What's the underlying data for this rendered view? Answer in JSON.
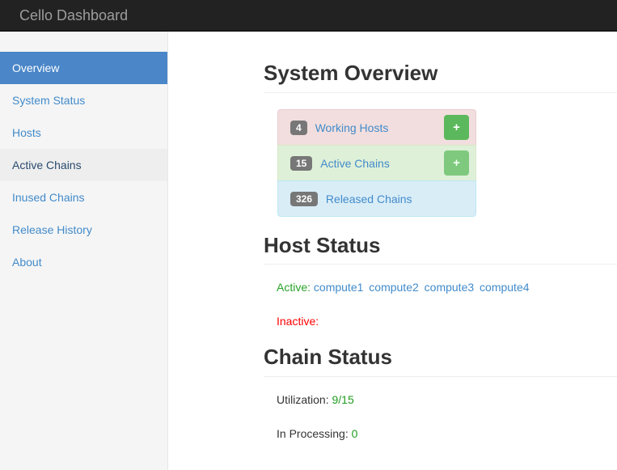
{
  "navbar": {
    "brand": "Cello Dashboard"
  },
  "sidebar": {
    "items": [
      {
        "label": "Overview",
        "name": "sidebar-item-overview",
        "state": "active"
      },
      {
        "label": "System Status",
        "name": "sidebar-item-system-status",
        "state": "normal"
      },
      {
        "label": "Hosts",
        "name": "sidebar-item-hosts",
        "state": "normal"
      },
      {
        "label": "Active Chains",
        "name": "sidebar-item-active-chains",
        "state": "hovered"
      },
      {
        "label": "Inused Chains",
        "name": "sidebar-item-inused-chains",
        "state": "normal"
      },
      {
        "label": "Release History",
        "name": "sidebar-item-release-history",
        "state": "normal"
      },
      {
        "label": "About",
        "name": "sidebar-item-about",
        "state": "normal"
      }
    ]
  },
  "system_overview": {
    "title": "System Overview",
    "items": [
      {
        "badge": "4",
        "label": "Working Hosts",
        "add_label": "+"
      },
      {
        "badge": "15",
        "label": "Active Chains",
        "add_label": "+"
      },
      {
        "badge": "326",
        "label": "Released Chains",
        "add_label": ""
      }
    ]
  },
  "host_status": {
    "title": "Host Status",
    "active_label": "Active:",
    "active_hosts": [
      "compute1",
      "compute2",
      "compute3",
      "compute4"
    ],
    "inactive_label": "Inactive:",
    "inactive_hosts": []
  },
  "chain_status": {
    "title": "Chain Status",
    "utilization_label": "Utilization:",
    "utilization_value": "9/15",
    "processing_label": "In Processing:",
    "processing_value": "0"
  },
  "colors": {
    "navbar_bg": "#222222",
    "active_nav": "#4a86c8",
    "link": "#428bca",
    "danger_bg": "#f2dede",
    "success_bg": "#dff0d8",
    "info_bg": "#d9edf7",
    "badge_bg": "#777777",
    "btn_success": "#5cb85c",
    "green_text": "#27a327",
    "red_text": "#ff0000"
  }
}
